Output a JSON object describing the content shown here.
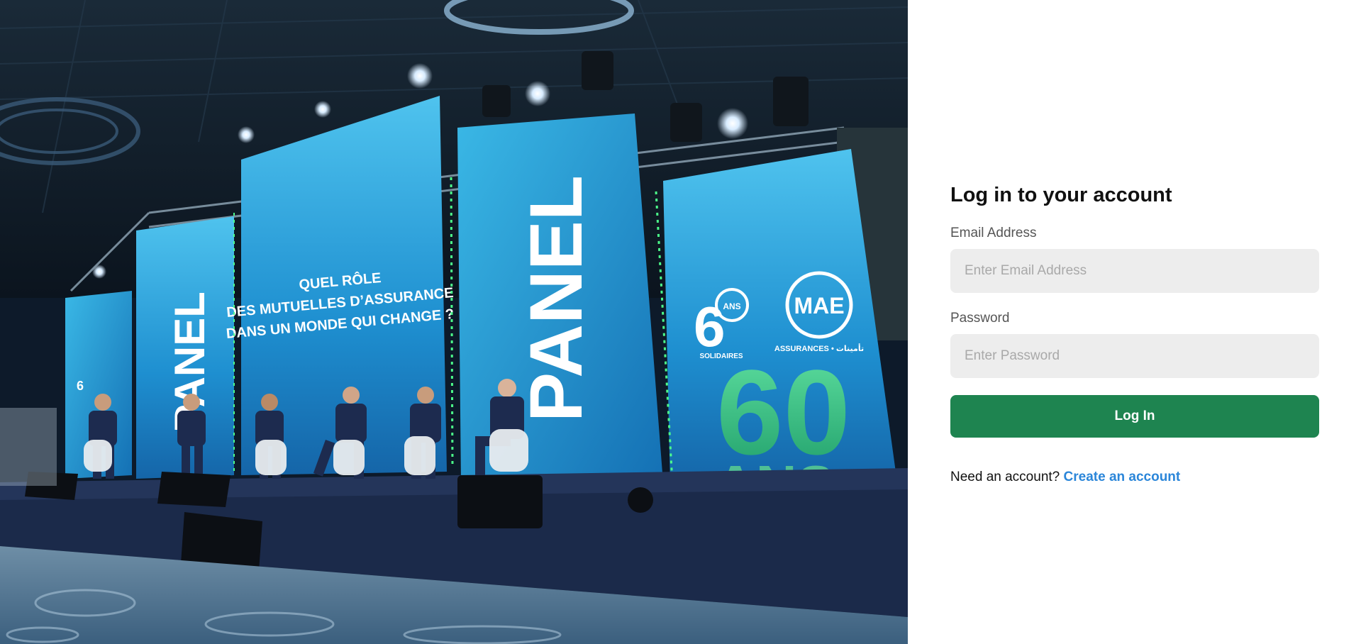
{
  "hero": {
    "screen_left_text": "PANEL",
    "screen_center_lines": [
      "QUEL RÔLE",
      "DES MUTUELLES D’ASSURANCE",
      "DANS UN MONDE QUI CHANGE ?"
    ],
    "screen_middle_text": "PANEL",
    "logo_60_ans_badge": "ANS",
    "logo_60_caption": "SOLIDAIRES",
    "logo_mae": "MAE",
    "logo_mae_caption": "ASSURANCES • تأمينات",
    "sculpture_number": "60",
    "sculpture_word": "ANS"
  },
  "login": {
    "title": "Log in to your account",
    "email_label": "Email Address",
    "email_placeholder": "Enter Email Address",
    "email_value": "",
    "password_label": "Password",
    "password_placeholder": "Enter Password",
    "password_value": "",
    "submit_label": "Log In",
    "signup_prompt": "Need an account?",
    "signup_link": "Create an account"
  },
  "colors": {
    "accent_button": "#1e8450",
    "link": "#2b86d9",
    "input_background": "#ededed"
  }
}
